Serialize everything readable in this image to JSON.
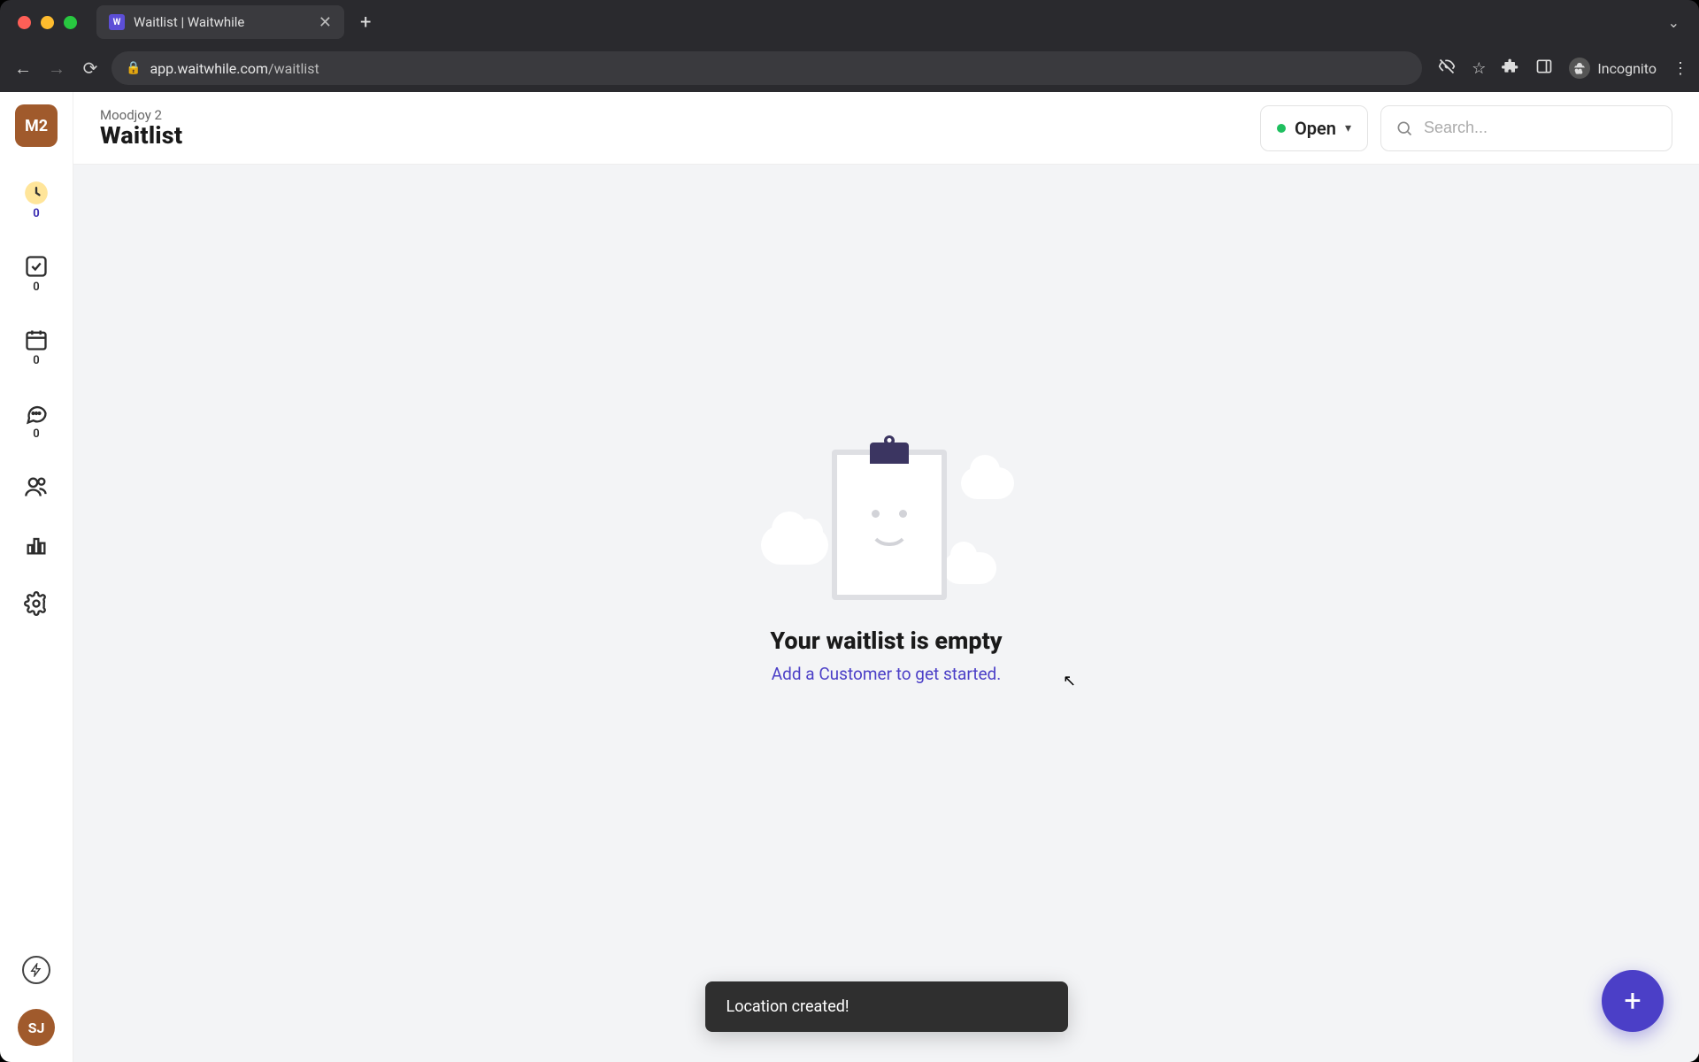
{
  "browser": {
    "tab_title": "Waitlist | Waitwhile",
    "url_host": "app.waitwhile.com",
    "url_path": "/waitlist",
    "incognito_label": "Incognito"
  },
  "sidebar": {
    "workspace_badge": "M2",
    "items": [
      {
        "id": "waitlist",
        "count": "0"
      },
      {
        "id": "served",
        "count": "0"
      },
      {
        "id": "bookings",
        "count": "0"
      },
      {
        "id": "messages",
        "count": "0"
      },
      {
        "id": "customers"
      },
      {
        "id": "analytics"
      },
      {
        "id": "settings"
      }
    ],
    "user_initials": "SJ"
  },
  "header": {
    "org_name": "Moodjoy 2",
    "page_title": "Waitlist",
    "status_label": "Open",
    "search_placeholder": "Search..."
  },
  "empty_state": {
    "heading": "Your waitlist is empty",
    "cta": "Add a Customer to get started."
  },
  "toast": {
    "message": "Location created!"
  },
  "fab": {
    "glyph": "+"
  },
  "colors": {
    "accent": "#4b3fc7",
    "status_open": "#1fbf5f",
    "workspace": "#a05a2c"
  }
}
